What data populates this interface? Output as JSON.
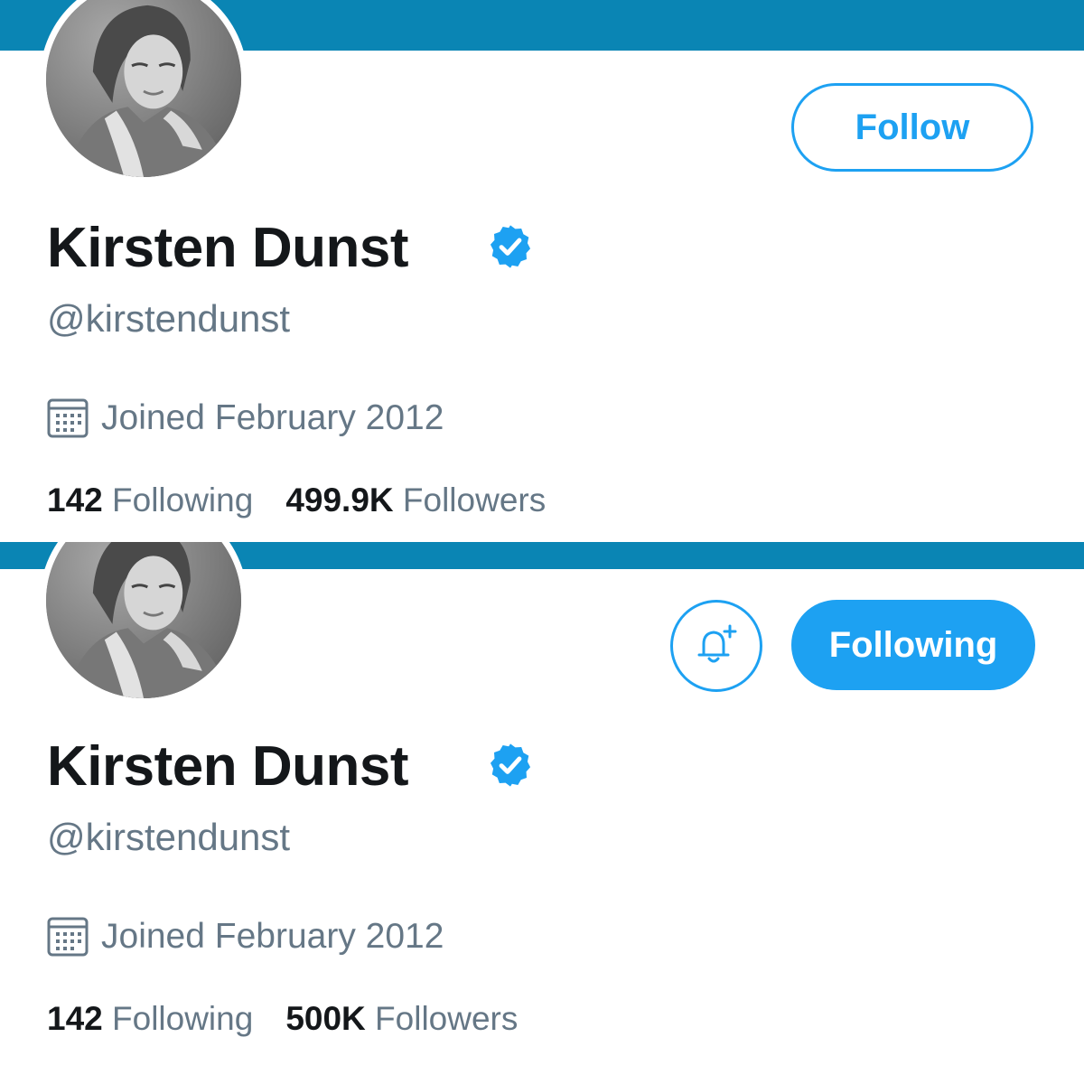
{
  "colors": {
    "banner": "#0a85b4",
    "accent": "#1da1f2",
    "text_primary": "#14171a",
    "text_secondary": "#657786"
  },
  "panels": [
    {
      "state": "not-following",
      "display_name": "Kirsten Dunst",
      "verified": true,
      "handle": "@kirstendunst",
      "joined": "Joined February 2012",
      "following_count": "142",
      "following_label": "Following",
      "followers_count": "499.9K",
      "followers_label": "Followers",
      "follow_button": "Follow"
    },
    {
      "state": "following",
      "display_name": "Kirsten Dunst",
      "verified": true,
      "handle": "@kirstendunst",
      "joined": "Joined February 2012",
      "following_count": "142",
      "following_label": "Following",
      "followers_count": "500K",
      "followers_label": "Followers",
      "following_button": "Following",
      "notification_icon": "bell-plus-icon"
    }
  ]
}
